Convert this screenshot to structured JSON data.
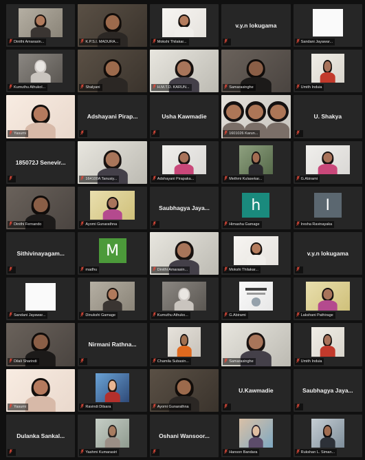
{
  "meeting": {
    "tiles": [
      {
        "kind": "video",
        "label": "Dinithi Amarasin...",
        "palette": "woman-indoor"
      },
      {
        "kind": "video",
        "label": "K.P.S.I. MADURA...",
        "palette": "woman-dark"
      },
      {
        "kind": "video",
        "label": "Mokshi Thilakar...",
        "palette": "woman-bright"
      },
      {
        "kind": "name",
        "name": "v.y.n lokugama",
        "label": ""
      },
      {
        "kind": "whitebox",
        "label": "Sandani Jayawar..."
      },
      {
        "kind": "video",
        "label": "Kumuthu Athukol...",
        "palette": "cat"
      },
      {
        "kind": "video",
        "label": "Shalyani",
        "palette": "woman-dark"
      },
      {
        "kind": "video",
        "label": "H.M.T.D. KARUN...",
        "palette": "woman-window"
      },
      {
        "kind": "video",
        "label": "Samarasinghe",
        "palette": "woman-dim"
      },
      {
        "kind": "video",
        "label": "Umith Induia",
        "palette": "man-red"
      },
      {
        "kind": "video",
        "label": "Yasumi",
        "palette": "woman-close"
      },
      {
        "kind": "name",
        "name": "Adshayani Pirap...",
        "label": ""
      },
      {
        "kind": "name",
        "name": "Usha Kawmadie",
        "label": ""
      },
      {
        "kind": "video",
        "label": "1601026 Karun...",
        "palette": "group"
      },
      {
        "kind": "name",
        "name": "U. Shakya",
        "label": ""
      },
      {
        "kind": "name",
        "name": "185072J Senevir...",
        "label": ""
      },
      {
        "kind": "video",
        "label": "164100A Tanusiy...",
        "palette": "woman-window"
      },
      {
        "kind": "video",
        "label": "Adshayani Pirapaka...",
        "palette": "woman-pink"
      },
      {
        "kind": "video",
        "label": "Methmi Kulasekar...",
        "palette": "woman-plant"
      },
      {
        "kind": "video",
        "label": "G.Abirami",
        "palette": "woman-pink"
      },
      {
        "kind": "video",
        "label": "Dinithi Fernando",
        "palette": "woman-dim"
      },
      {
        "kind": "video",
        "label": "Ayomi Gunarathna",
        "palette": "woman-yellow"
      },
      {
        "kind": "name",
        "name": "Saubhagya Jaya...",
        "label": ""
      },
      {
        "kind": "letter",
        "letter": "h",
        "color": "#1a8a7d",
        "label": "Himasha Gamage"
      },
      {
        "kind": "letter",
        "letter": "I",
        "color": "#5b6770",
        "label": "Iresha Ravinayaka"
      },
      {
        "kind": "name",
        "name": "Sithivinayagam...",
        "label": ""
      },
      {
        "kind": "letter",
        "letter": "M",
        "color": "#4c9a3a",
        "label": "madhu"
      },
      {
        "kind": "video",
        "label": "Dinithi Amarasin...",
        "palette": "woman-window"
      },
      {
        "kind": "video",
        "label": "Mokshi Thilakar...",
        "palette": "woman-bright"
      },
      {
        "kind": "name",
        "name": "v.y.n lokugama",
        "label": ""
      },
      {
        "kind": "whitebox",
        "label": "Sandani Jayawar..."
      },
      {
        "kind": "video",
        "label": "Dinukshi Gamage",
        "palette": "woman-indoor"
      },
      {
        "kind": "video",
        "label": "Kumuthu Athuko...",
        "palette": "cat"
      },
      {
        "kind": "video",
        "label": "G.Abirami",
        "palette": "screen-text"
      },
      {
        "kind": "video",
        "label": "Lakshani Pathirage",
        "palette": "woman-yellow"
      },
      {
        "kind": "video",
        "label": "Dilali Sharindi",
        "palette": "woman-dim"
      },
      {
        "kind": "name",
        "name": "Nirmani Rathna...",
        "label": ""
      },
      {
        "kind": "video",
        "label": "Chamila Subasin...",
        "palette": "man-orange"
      },
      {
        "kind": "video",
        "label": "Samarasinghe",
        "palette": "woman-window"
      },
      {
        "kind": "video",
        "label": "Umith Induia",
        "palette": "man-red"
      },
      {
        "kind": "video",
        "label": "Yasumi",
        "palette": "woman-close"
      },
      {
        "kind": "video",
        "label": "Ravindi Dilsara",
        "palette": "cartoon"
      },
      {
        "kind": "video",
        "label": "Ayomi Gunarathna",
        "palette": "woman-dark"
      },
      {
        "kind": "name",
        "name": "U.Kawmadie",
        "label": ""
      },
      {
        "kind": "name",
        "name": "Saubhagya Jaya...",
        "label": ""
      },
      {
        "kind": "name",
        "name": "Dulanka Sankal...",
        "label": ""
      },
      {
        "kind": "video",
        "label": "Yashmi Kumarasiri",
        "palette": "outdoor"
      },
      {
        "kind": "name",
        "name": "Oshani Wansoor...",
        "label": ""
      },
      {
        "kind": "video",
        "label": "Hanson Bandara",
        "palette": "cartoon-face"
      },
      {
        "kind": "video",
        "label": "Rukshan L. Siman...",
        "palette": "man-glasses"
      }
    ]
  }
}
